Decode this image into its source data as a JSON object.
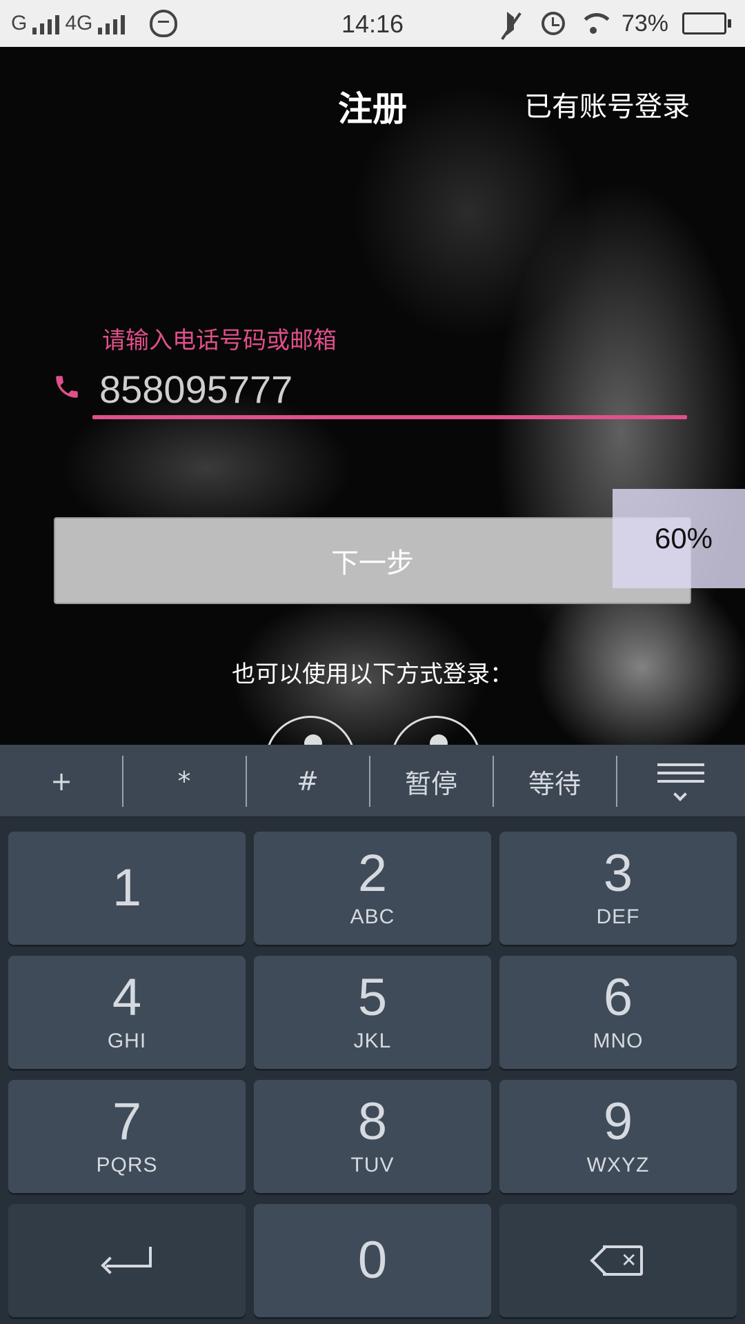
{
  "status_bar": {
    "carrier1": "G",
    "carrier2": "4G",
    "time": "14:16",
    "battery": "73%",
    "battery_level": 0.73,
    "icons": [
      "signal-icon",
      "qq-icon",
      "mute-icon",
      "alarm-icon",
      "wifi-icon",
      "battery-icon"
    ]
  },
  "header": {
    "title": "注册",
    "login_link": "已有账号登录"
  },
  "form": {
    "hint": "请输入电话号码或邮箱",
    "phone_value": "858095777",
    "accent": "#e0508a",
    "next_label": "下一步"
  },
  "progress_badge": "60%",
  "alt_login": "也可以使用以下方式登录：",
  "keyboard": {
    "toolbar": [
      "+",
      "*",
      "#",
      "暂停",
      "等待"
    ],
    "keys": [
      {
        "num": "1",
        "sub": ""
      },
      {
        "num": "2",
        "sub": "ABC"
      },
      {
        "num": "3",
        "sub": "DEF"
      },
      {
        "num": "4",
        "sub": "GHI"
      },
      {
        "num": "5",
        "sub": "JKL"
      },
      {
        "num": "6",
        "sub": "MNO"
      },
      {
        "num": "7",
        "sub": "PQRS"
      },
      {
        "num": "8",
        "sub": "TUV"
      },
      {
        "num": "9",
        "sub": "WXYZ"
      },
      {
        "num": "0",
        "sub": ""
      }
    ]
  }
}
